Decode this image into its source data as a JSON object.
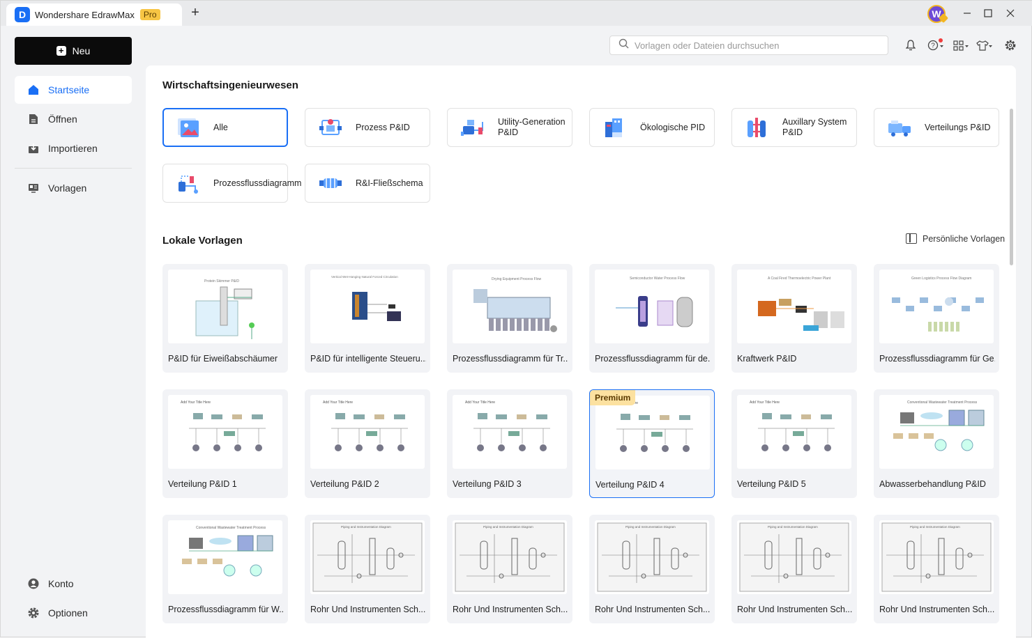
{
  "app": {
    "name": "Wondershare EdrawMax",
    "badge": "Pro",
    "avatar_letter": "W",
    "brand_color": "#1a6ff5"
  },
  "sidebar": {
    "new_label": "Neu",
    "items": [
      {
        "label": "Startseite",
        "icon": "home-icon",
        "active": true
      },
      {
        "label": "Öffnen",
        "icon": "file-icon"
      },
      {
        "label": "Importieren",
        "icon": "import-icon"
      },
      {
        "label": "Vorlagen",
        "icon": "templates-icon"
      }
    ],
    "bottom": [
      {
        "label": "Konto",
        "icon": "user-icon"
      },
      {
        "label": "Optionen",
        "icon": "gear-icon"
      }
    ]
  },
  "search": {
    "placeholder": "Vorlagen oder Dateien durchsuchen"
  },
  "categories_section": {
    "title": "Wirtschaftsingenieurwesen",
    "items": [
      {
        "label": "Alle",
        "selected": true
      },
      {
        "label": "Prozess P&ID"
      },
      {
        "label": "Utility-Generation P&ID"
      },
      {
        "label": "Ökologische PID"
      },
      {
        "label": "Auxillary System P&ID"
      },
      {
        "label": "Verteilungs P&ID"
      },
      {
        "label": "Prozessflussdiagramm"
      },
      {
        "label": "R&I-Fließschema"
      }
    ]
  },
  "templates_section": {
    "title": "Lokale Vorlagen",
    "personal_label": "Persönliche Vorlagen",
    "items": [
      {
        "name": "P&ID für Eiweißabschäumer",
        "style": "tank"
      },
      {
        "name": "P&ID für intelligente Steueru...",
        "style": "panel"
      },
      {
        "name": "Prozessflussdiagramm für Tr...",
        "style": "machine"
      },
      {
        "name": "Prozessflussdiagramm für de...",
        "style": "vessel"
      },
      {
        "name": "Kraftwerk P&ID",
        "style": "plant"
      },
      {
        "name": "Prozessflussdiagramm für Ge...",
        "style": "logistics"
      },
      {
        "name": "Verteilung P&ID 1",
        "style": "dist"
      },
      {
        "name": "Verteilung P&ID 2",
        "style": "dist"
      },
      {
        "name": "Verteilung P&ID 3",
        "style": "dist"
      },
      {
        "name": "Verteilung P&ID 4",
        "style": "dist",
        "premium": "Premium"
      },
      {
        "name": "Verteilung P&ID 5",
        "style": "dist"
      },
      {
        "name": "Abwasserbehandlung P&ID",
        "style": "water"
      },
      {
        "name": "Prozessflussdiagramm für W...",
        "style": "water"
      },
      {
        "name": "Rohr  Und Instrumenten Sch...",
        "style": "piping"
      },
      {
        "name": "Rohr  Und Instrumenten Sch...",
        "style": "piping"
      },
      {
        "name": "Rohr  Und Instrumenten Sch...",
        "style": "piping"
      },
      {
        "name": "Rohr  Und Instrumenten Sch...",
        "style": "piping"
      },
      {
        "name": "Rohr  Und Instrumenten Sch...",
        "style": "piping"
      }
    ]
  }
}
